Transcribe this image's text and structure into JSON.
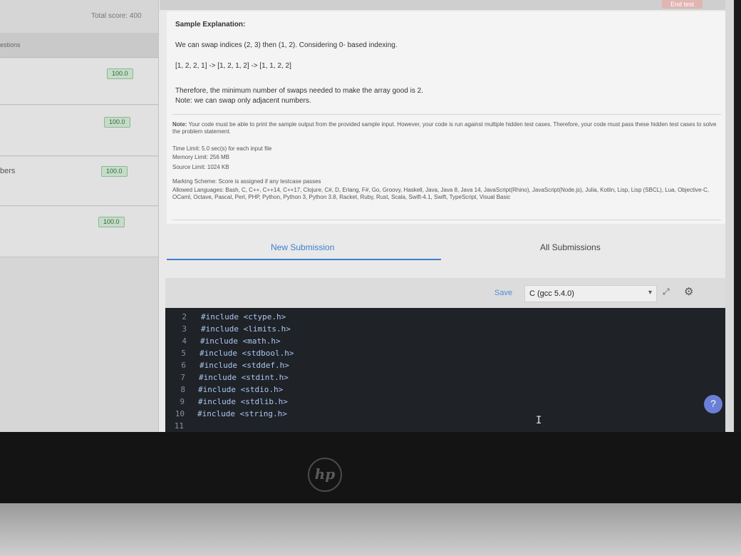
{
  "topbar": {
    "end_test": "End test"
  },
  "sidebar": {
    "total_score": "Total score: 400",
    "header": "estions",
    "questions": [
      {
        "label": "",
        "score": "100.0"
      },
      {
        "label": "",
        "score": "100.0"
      },
      {
        "label": "bers",
        "score": "100.0"
      },
      {
        "label": "",
        "score": "100.0"
      }
    ]
  },
  "problem": {
    "heading": "Sample Explanation:",
    "line1": "We can swap indices (2, 3) then (1, 2). Considering 0- based indexing.",
    "line2": "[1, 2, 2, 1] -> [1, 2, 1, 2] -> [1, 1, 2, 2]",
    "line3": "Therefore, the minimum number of swaps needed to make the array good is 2.",
    "line4": "Note: we can swap only adjacent numbers.",
    "note_label": "Note:",
    "note_text": "Your code must be able to print the sample output from the provided sample input. However, your code is run against multiple hidden test cases. Therefore, your code must pass these hidden test cases to solve the problem statement.",
    "time_limit": "Time Limit: 5.0 sec(s) for each input file",
    "memory_limit": "Memory Limit: 256 MB",
    "source_limit": "Source Limit: 1024 KB",
    "marking_scheme": "Marking Scheme: Score is assigned if any testcase passes",
    "allowed_languages": "Allowed Languages: Bash, C, C++, C++14, C++17, Clojure, C#, D, Erlang, F#, Go, Groovy, Haskell, Java, Java 8, Java 14, JavaScript(Rhino), JavaScript(Node.js), Julia, Kotlin, Lisp, Lisp (SBCL), Lua, Objective-C, OCaml, Octave, Pascal, Perl, PHP, Python, Python 3, Python 3.8, Racket, Ruby, Rust, Scala, Swift-4.1, Swift, TypeScript, Visual Basic"
  },
  "tabs": {
    "new_submission": "New Submission",
    "all_submissions": "All Submissions"
  },
  "editor": {
    "save": "Save",
    "language": "C (gcc 5.4.0)",
    "lines": [
      {
        "n": "2",
        "code": "#include <ctype.h>"
      },
      {
        "n": "3",
        "code": "#include <limits.h>"
      },
      {
        "n": "4",
        "code": "#include <math.h>"
      },
      {
        "n": "5",
        "code": "#include <stdbool.h>"
      },
      {
        "n": "6",
        "code": "#include <stddef.h>"
      },
      {
        "n": "7",
        "code": "#include <stdint.h>"
      },
      {
        "n": "8",
        "code": "#include <stdio.h>"
      },
      {
        "n": "9",
        "code": "#include <stdlib.h>"
      },
      {
        "n": "10",
        "code": "#include <string.h>"
      },
      {
        "n": "11",
        "code": ""
      }
    ]
  },
  "help": "?",
  "brand": "hp"
}
